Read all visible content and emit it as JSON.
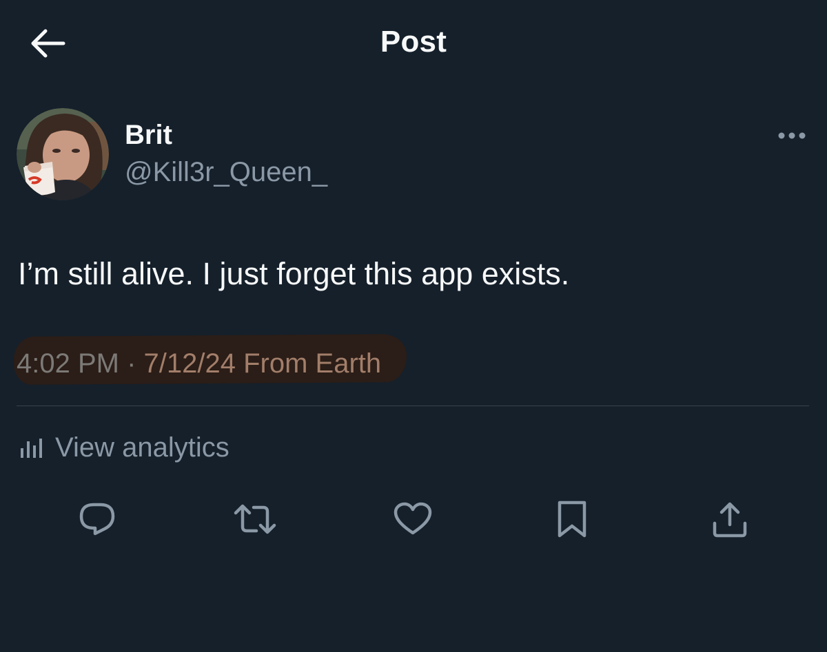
{
  "header": {
    "title": "Post",
    "back_icon": "arrow-left-icon"
  },
  "post": {
    "author": {
      "display_name": "Brit",
      "handle": "@Kill3r_Queen_",
      "avatar": "profile-photo"
    },
    "more_icon": "more-horizontal-icon",
    "text": "I’m still alive. I just forget this app exists.",
    "meta": {
      "time": "4:02 PM",
      "separator": " · ",
      "date": "7/12/24",
      "source": "From Earth",
      "highlight_color": "#2b1d17"
    },
    "analytics": {
      "label": "View analytics",
      "icon": "bar-chart-icon"
    },
    "actions": [
      {
        "name": "reply",
        "icon": "comment-icon"
      },
      {
        "name": "repost",
        "icon": "retweet-icon"
      },
      {
        "name": "like",
        "icon": "heart-icon"
      },
      {
        "name": "bookmark",
        "icon": "bookmark-icon"
      },
      {
        "name": "share",
        "icon": "share-icon"
      }
    ]
  },
  "theme": {
    "background": "#15202b",
    "text_primary": "#f7f9f9",
    "text_secondary": "#8b98a5",
    "divider": "#38444d"
  }
}
